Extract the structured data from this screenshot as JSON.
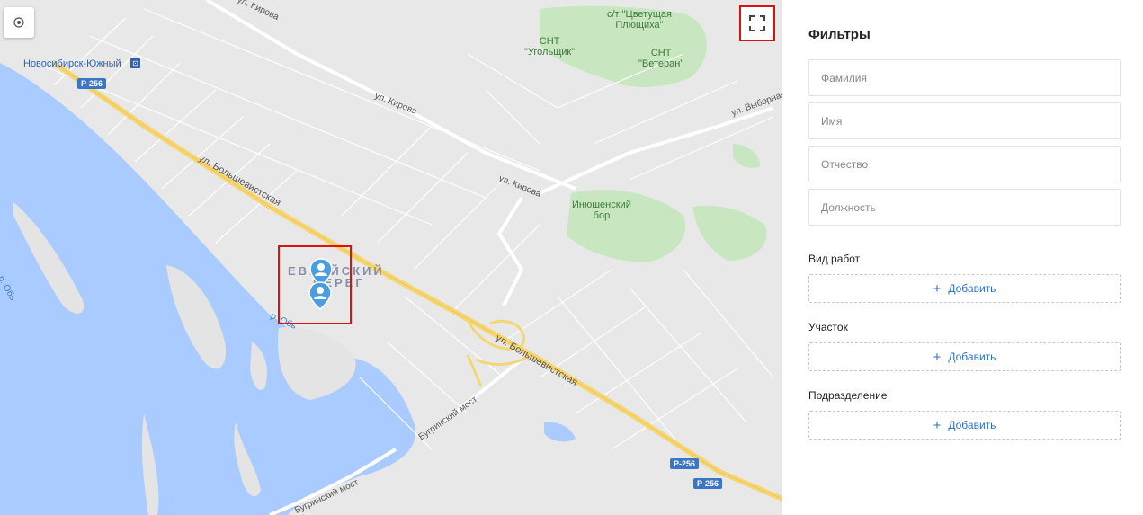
{
  "map": {
    "labels": {
      "city_station": "Новосибирск-Южный",
      "snt_flowering_1": "с/т \"Цветущая",
      "snt_flowering_2": "Плющиха\"",
      "snt_coal_1": "СНТ",
      "snt_coal_2": "\"Угольщик\"",
      "snt_veteran_1": "СНТ",
      "snt_veteran_2": "\"Ветеран\"",
      "kirova_1": "ул. Кирова",
      "kirova_2": "ул. Кирова",
      "kirova_3": "ул. Кирова",
      "vybornaya": "ул. Выборная",
      "bolshevistskaya_1": "ул. Большевистская",
      "bolshevistskaya_2": "ул. Большевистская",
      "inyushensky_1": "Инюшенский",
      "inyushensky_2": "бор",
      "district_1": "ЕВРЕЙСКИЙ",
      "district_2": "БЕРЕГ",
      "bugrinsky_1": "Бугринский мост",
      "bugrinsky_2": "Бугринский мост",
      "ob_1": "р. Обь",
      "ob_2": "р. Обь"
    },
    "shields": {
      "r256_a": "Р-256",
      "r256_b": "Р-256",
      "r256_c": "Р-256"
    },
    "colors": {
      "water": "#aacbff",
      "land": "#e8e8e8",
      "park": "#c8e6c0",
      "highway": "#f5d676",
      "road": "#ffffff",
      "marker": "#4a9ee0",
      "highlight": "#dd1111"
    },
    "icons": {
      "locate": "locate-icon",
      "fullscreen": "fullscreen-icon",
      "marker": "person-marker-icon"
    }
  },
  "filters": {
    "title": "Фильтры",
    "surname_placeholder": "Фамилия",
    "name_placeholder": "Имя",
    "patronymic_placeholder": "Отчество",
    "position_placeholder": "Должность",
    "work_type_label": "Вид работ",
    "site_label": "Участок",
    "department_label": "Подразделение",
    "add_label": "Добавить",
    "accent_color": "#2f6fc6"
  }
}
